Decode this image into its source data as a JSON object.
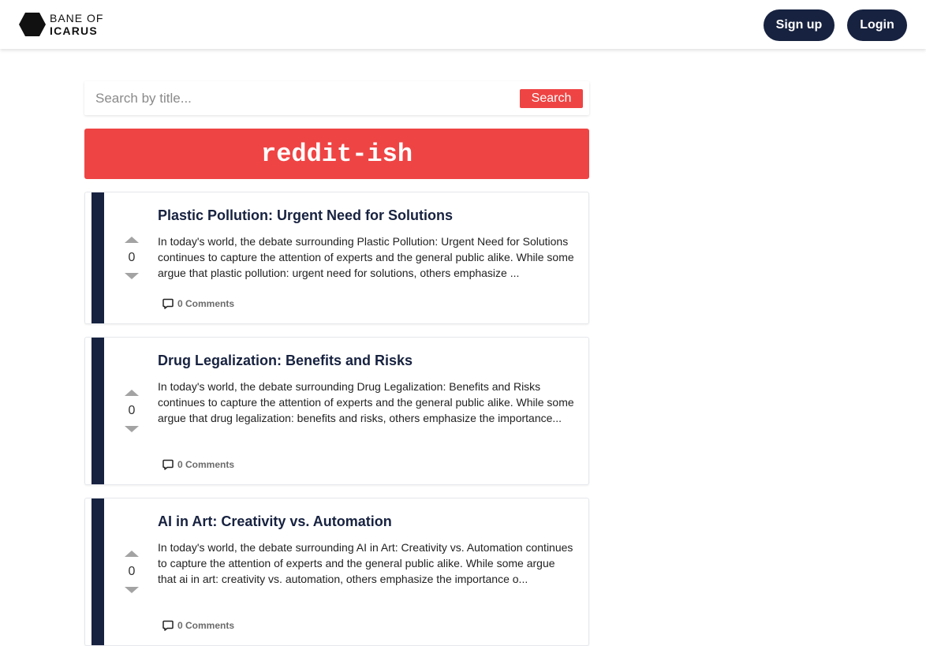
{
  "brand": {
    "line1": "BANE OF",
    "line2": "ICARUS"
  },
  "nav": {
    "signup_label": "Sign up",
    "login_label": "Login"
  },
  "search": {
    "placeholder": "Search by title...",
    "button_label": "Search"
  },
  "banner": {
    "title": "reddit-ish"
  },
  "colors": {
    "accent": "#ef4444",
    "navy": "#172240"
  },
  "posts": [
    {
      "title": "Plastic Pollution: Urgent Need for Solutions",
      "excerpt": "In today's world, the debate surrounding Plastic Pollution: Urgent Need for Solutions continues to capture the attention of experts and the general public alike. While some argue that plastic pollution: urgent need for solutions, others emphasize ...",
      "votes": "0",
      "comments": "0 Comments"
    },
    {
      "title": "Drug Legalization: Benefits and Risks",
      "excerpt": "In today's world, the debate surrounding Drug Legalization: Benefits and Risks continues to capture the attention of experts and the general public alike. While some argue that drug legalization: benefits and risks, others emphasize the importance...",
      "votes": "0",
      "comments": "0 Comments"
    },
    {
      "title": "AI in Art: Creativity vs. Automation",
      "excerpt": "In today's world, the debate surrounding AI in Art: Creativity vs. Automation continues to capture the attention of experts and the general public alike. While some argue that ai in art: creativity vs. automation, others emphasize the importance o...",
      "votes": "0",
      "comments": "0 Comments"
    }
  ]
}
